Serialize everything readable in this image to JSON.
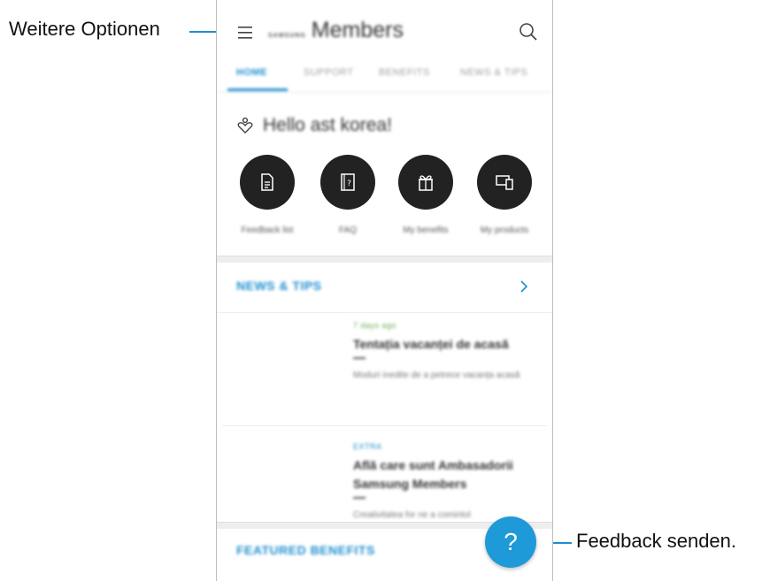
{
  "annotations": {
    "menu_callout": "Weitere Optionen",
    "feedback_callout": "Feedback senden."
  },
  "appbar": {
    "brand_small": "SAMSUNG",
    "title": "Members",
    "menu_icon": "hamburger-menu-icon",
    "search_icon": "search-icon"
  },
  "tabs": [
    {
      "label": "HOME",
      "active": true
    },
    {
      "label": "SUPPORT",
      "active": false
    },
    {
      "label": "BENEFITS",
      "active": false
    },
    {
      "label": "NEWS & TIPS",
      "active": false
    }
  ],
  "greeting": "Hello ast korea!",
  "quick_actions": [
    {
      "label": "Feedback list",
      "icon": "document-icon"
    },
    {
      "label": "FAQ",
      "icon": "faq-icon"
    },
    {
      "label": "My benefits",
      "icon": "gift-icon"
    },
    {
      "label": "My products",
      "icon": "devices-icon"
    }
  ],
  "news_section": {
    "title": "NEWS & TIPS",
    "items": [
      {
        "category": "7 days ago",
        "title": "Tentația vacanței de acasă",
        "desc": "Moduri inedite de a petrece vacanța acasă"
      },
      {
        "category": "EXTRA",
        "title": "Află care sunt Ambasadorii Samsung Members",
        "desc": "Creativitatea for ne a comintol"
      }
    ]
  },
  "featured_section": {
    "title": "FEATURED BENEFITS"
  },
  "fab": {
    "label": "?"
  },
  "colors": {
    "accent": "#1f8fd0",
    "fab": "#1f9ad8",
    "icon_bg": "#222222"
  }
}
